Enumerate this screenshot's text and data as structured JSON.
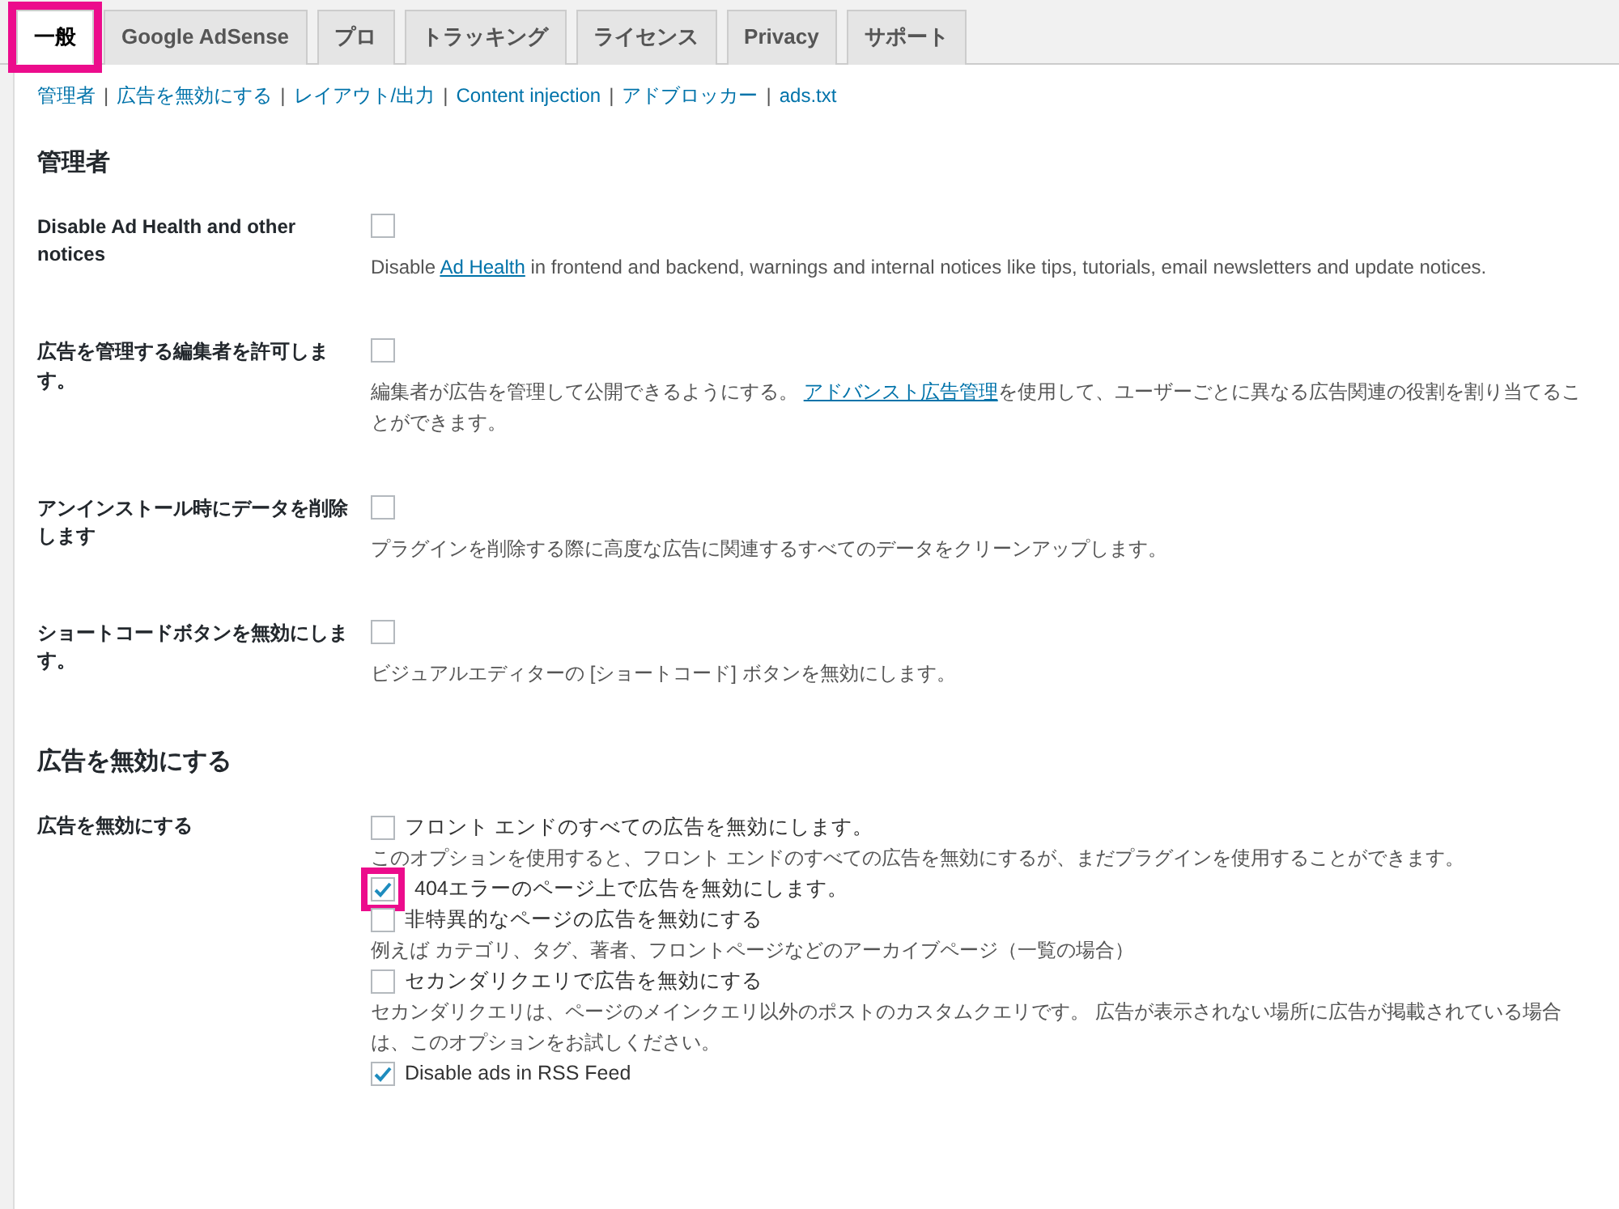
{
  "tabs": [
    {
      "label": "一般",
      "selected": true,
      "highlighted": true
    },
    {
      "label": "Google AdSense",
      "selected": false,
      "highlighted": false
    },
    {
      "label": "プロ",
      "selected": false,
      "highlighted": false
    },
    {
      "label": "トラッキング",
      "selected": false,
      "highlighted": false
    },
    {
      "label": "ライセンス",
      "selected": false,
      "highlighted": false
    },
    {
      "label": "Privacy",
      "selected": false,
      "highlighted": false
    },
    {
      "label": "サポート",
      "selected": false,
      "highlighted": false
    }
  ],
  "subnav_separator": "|",
  "subnav": [
    "管理者",
    "広告を無効にする",
    "レイアウト/出力",
    "Content injection",
    "アドブロッカー",
    "ads.txt"
  ],
  "sections": [
    {
      "title": "管理者",
      "rows": [
        {
          "label": "Disable Ad Health and other notices",
          "checked": false,
          "description": [
            {
              "text": "Disable ",
              "link": false
            },
            {
              "text": "Ad Health",
              "link": true
            },
            {
              "text": " in frontend and backend, warnings and internal notices like tips, tutorials, email newsletters and update notices.",
              "link": false
            }
          ]
        },
        {
          "label": "広告を管理する編集者を許可します。",
          "checked": false,
          "description": [
            {
              "text": "編集者が広告を管理して公開できるようにする。 ",
              "link": false
            },
            {
              "text": "アドバンスト広告管理",
              "link": true
            },
            {
              "text": "を使用して、ユーザーごとに異なる広告関連の役割を割り当てることができます。",
              "link": false
            }
          ]
        },
        {
          "label": "アンインストール時にデータを削除します",
          "checked": false,
          "description": [
            {
              "text": "プラグインを削除する際に高度な広告に関連するすべてのデータをクリーンアップします。",
              "link": false
            }
          ]
        },
        {
          "label": "ショートコードボタンを無効にします。",
          "checked": false,
          "description": [
            {
              "text": "ビジュアルエディターの [ショートコード] ボタンを無効にします。",
              "link": false
            }
          ]
        }
      ]
    },
    {
      "title": "広告を無効にする",
      "rows": [
        {
          "label": "広告を無効にする",
          "options": [
            {
              "label": "フロント エンドのすべての広告を無効にします。",
              "checked": false,
              "highlighted": false,
              "description": "このオプションを使用すると、フロント エンドのすべての広告を無効にするが、まだプラグインを使用することができます。"
            },
            {
              "label": "404エラーのページ上で広告を無効にします。",
              "checked": true,
              "highlighted": true
            },
            {
              "label": "非特異的なページの広告を無効にする",
              "checked": false,
              "highlighted": false,
              "description": "例えば カテゴリ、タグ、著者、フロントページなどのアーカイブページ（一覧の場合）"
            },
            {
              "label": "セカンダリクエリで広告を無効にする",
              "checked": false,
              "highlighted": false,
              "description": "セカンダリクエリは、ページのメインクエリ以外のポストのカスタムクエリです。 広告が表示されない場所に広告が掲載されている場合は、このオプションをお試しください。"
            },
            {
              "label": "Disable ads in RSS Feed",
              "checked": true,
              "highlighted": false
            }
          ]
        }
      ]
    }
  ]
}
